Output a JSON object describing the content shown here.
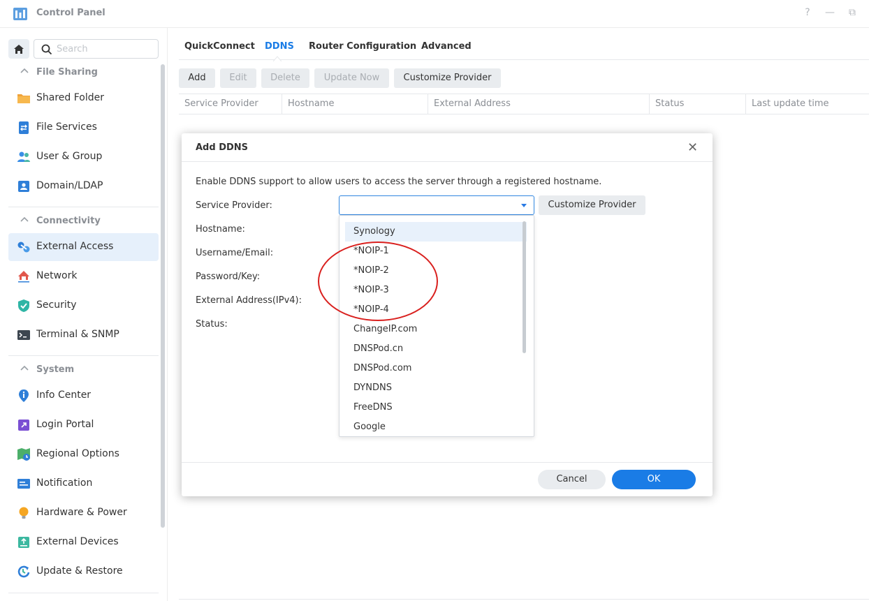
{
  "window": {
    "title": "Control Panel",
    "help_glyph": "?",
    "minimize_glyph": "—",
    "restore_glyph": "⧉"
  },
  "sidebar": {
    "search_placeholder": "Search",
    "groups": [
      {
        "label": "File Sharing",
        "items": [
          {
            "label": "Shared Folder",
            "icon": "folder-icon"
          },
          {
            "label": "File Services",
            "icon": "file-services-icon"
          },
          {
            "label": "User & Group",
            "icon": "user-group-icon"
          },
          {
            "label": "Domain/LDAP",
            "icon": "domain-ldap-icon"
          }
        ]
      },
      {
        "label": "Connectivity",
        "items": [
          {
            "label": "External Access",
            "icon": "external-access-icon"
          },
          {
            "label": "Network",
            "icon": "network-icon"
          },
          {
            "label": "Security",
            "icon": "security-shield-icon"
          },
          {
            "label": "Terminal & SNMP",
            "icon": "terminal-icon"
          }
        ]
      },
      {
        "label": "System",
        "items": [
          {
            "label": "Info Center",
            "icon": "info-icon"
          },
          {
            "label": "Login Portal",
            "icon": "login-portal-icon"
          },
          {
            "label": "Regional Options",
            "icon": "regional-options-icon"
          },
          {
            "label": "Notification",
            "icon": "notification-icon"
          },
          {
            "label": "Hardware & Power",
            "icon": "hardware-power-icon"
          },
          {
            "label": "External Devices",
            "icon": "external-devices-icon"
          },
          {
            "label": "Update & Restore",
            "icon": "update-restore-icon"
          }
        ]
      }
    ]
  },
  "tabs": [
    "QuickConnect",
    "DDNS",
    "Router Configuration",
    "Advanced"
  ],
  "active_tab": "DDNS",
  "toolbar": {
    "add": "Add",
    "edit": "Edit",
    "delete": "Delete",
    "update_now": "Update Now",
    "customize_provider": "Customize Provider"
  },
  "grid": {
    "columns": [
      "Service Provider",
      "Hostname",
      "External Address",
      "Status",
      "Last update time"
    ]
  },
  "dialog": {
    "title": "Add DDNS",
    "description": "Enable DDNS support to allow users to access the server through a registered hostname.",
    "labels": {
      "service_provider": "Service Provider:",
      "hostname": "Hostname:",
      "username": "Username/Email:",
      "password": "Password/Key:",
      "external_address": "External Address(IPv4):",
      "status": "Status:"
    },
    "service_provider_value": "",
    "customize_provider": "Customize Provider",
    "dropdown_options": [
      "Synology",
      "*NOIP-1",
      "*NOIP-2",
      "*NOIP-3",
      "*NOIP-4",
      "ChangeIP.com",
      "DNSPod.cn",
      "DNSPod.com",
      "DYNDNS",
      "FreeDNS",
      "Google"
    ],
    "highlighted_option": "Synology",
    "cancel": "Cancel",
    "ok": "OK"
  },
  "colors": {
    "accent": "#1a7ce6",
    "annotation_circle": "#d9201e",
    "active_nav_bg": "#e6f0fb"
  }
}
